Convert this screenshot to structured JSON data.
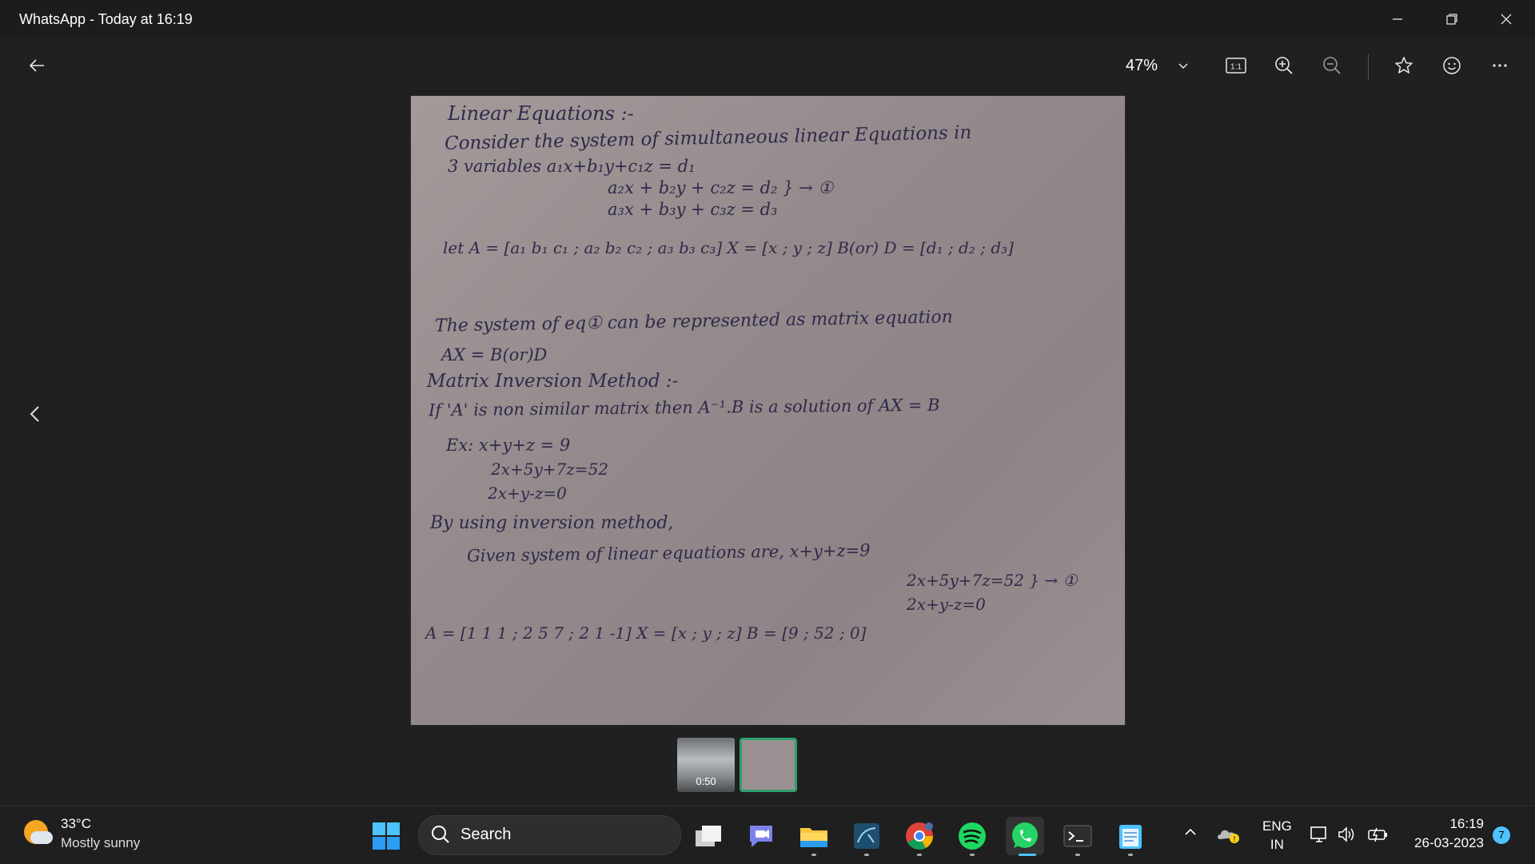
{
  "window": {
    "title": "WhatsApp - Today at 16:19",
    "minimize_icon": "minimize-icon",
    "restore_icon": "restore-icon",
    "close_icon": "close-icon"
  },
  "toolbar": {
    "zoom": "47%",
    "icons": [
      "back-arrow-icon",
      "chevron-down-icon",
      "actual-size-icon",
      "zoom-in-icon",
      "zoom-out-icon",
      "star-icon",
      "emoji-icon",
      "more-icon"
    ],
    "actual_size_label": "1:1"
  },
  "photo": {
    "lines": [
      "Linear Equations :-",
      "Consider the system of simultaneous linear Equations in",
      "3 variables   a₁x+b₁y+c₁z = d₁",
      "a₂x + b₂y + c₂z = d₂   } → ①",
      "a₃x + b₃y + c₃z = d₃",
      "let A = [a₁ b₁ c₁ ; a₂ b₂ c₂ ; a₃ b₃ c₃]    X = [x ; y ; z]    B(or) D = [d₁ ; d₂ ; d₃]",
      "The system of eq① can be represented as matrix equation",
      "AX = B(or)D",
      "Matrix Inversion Method :-",
      "If 'A' is non similar matrix then A⁻¹.B is a solution of AX = B",
      "Ex:   x+y+z = 9",
      "2x+5y+7z=52",
      "2x+y-z=0",
      "By using inversion method,",
      "Given system of linear equations are,  x+y+z=9",
      "2x+5y+7z=52 } → ①",
      "2x+y-z=0",
      "A = [1 1 1 ; 2 5 7 ; 2 1 -1]    X = [x ; y ; z]    B = [9 ; 52 ; 0]"
    ]
  },
  "filmstrip": {
    "video_duration": "0:50"
  },
  "taskbar": {
    "weather_temp": "33°C",
    "weather_desc": "Mostly sunny",
    "search_label": "Search",
    "lang_1": "ENG",
    "lang_2": "IN",
    "time": "16:19",
    "date": "26-03-2023",
    "notification_count": "7"
  }
}
